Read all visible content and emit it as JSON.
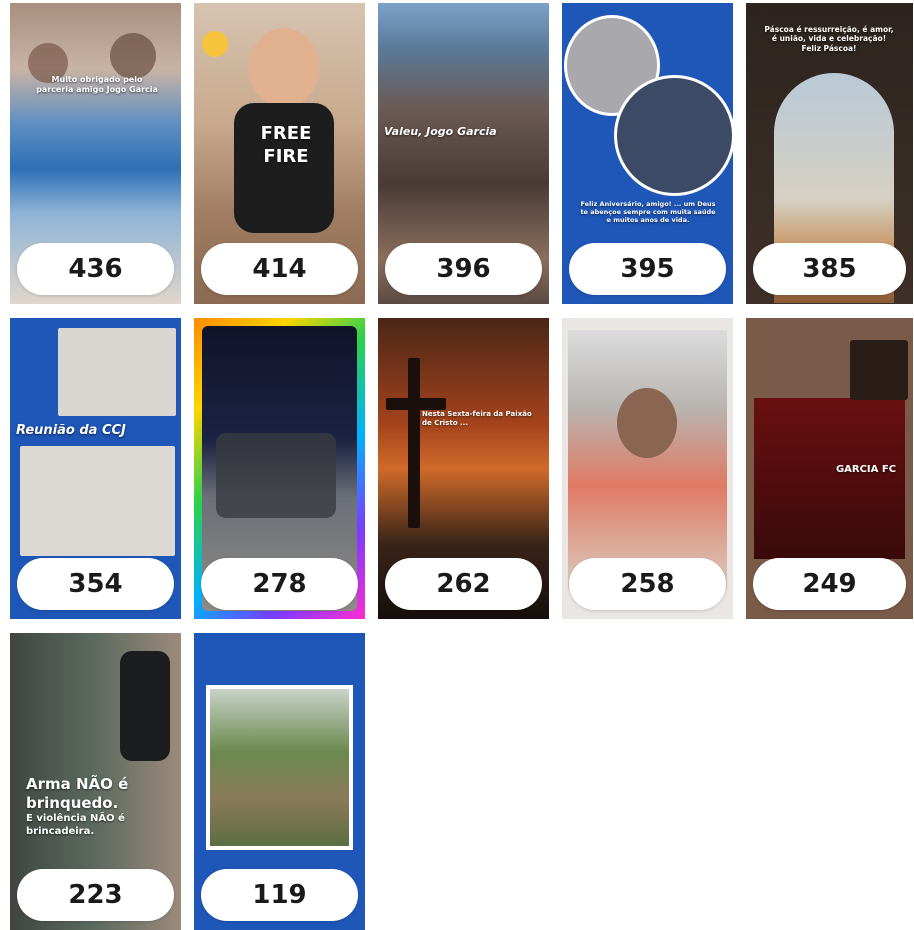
{
  "tiles": [
    {
      "count": "436",
      "overlay": "Muito obrigado pelo parceria amigo Jogo Garcia"
    },
    {
      "count": "414",
      "overlay": "FREE FIRE"
    },
    {
      "count": "396",
      "overlay": "Valeu, Jogo Garcia"
    },
    {
      "count": "395",
      "overlay": "Feliz Aniversário, amigo! ... um Deus te abençoe sempre com muita saúde e muitos anos de vida."
    },
    {
      "count": "385",
      "overlay": "Páscoa é ressurreição, é amor, é união, vida e celebração! Feliz Páscoa!"
    },
    {
      "count": "354",
      "overlay": "Reunião da CCJ"
    },
    {
      "count": "278",
      "overlay": ""
    },
    {
      "count": "262",
      "overlay": "Nesta Sexta-feira da Paixão de Cristo ..."
    },
    {
      "count": "258",
      "overlay": ""
    },
    {
      "count": "249",
      "overlay": "GARCIA FC"
    },
    {
      "count": "223",
      "overlay_a": "Arma NÃO é brinquedo.",
      "overlay_b": "E violência NÃO é brincadeira."
    },
    {
      "count": "119",
      "overlay": ""
    }
  ]
}
